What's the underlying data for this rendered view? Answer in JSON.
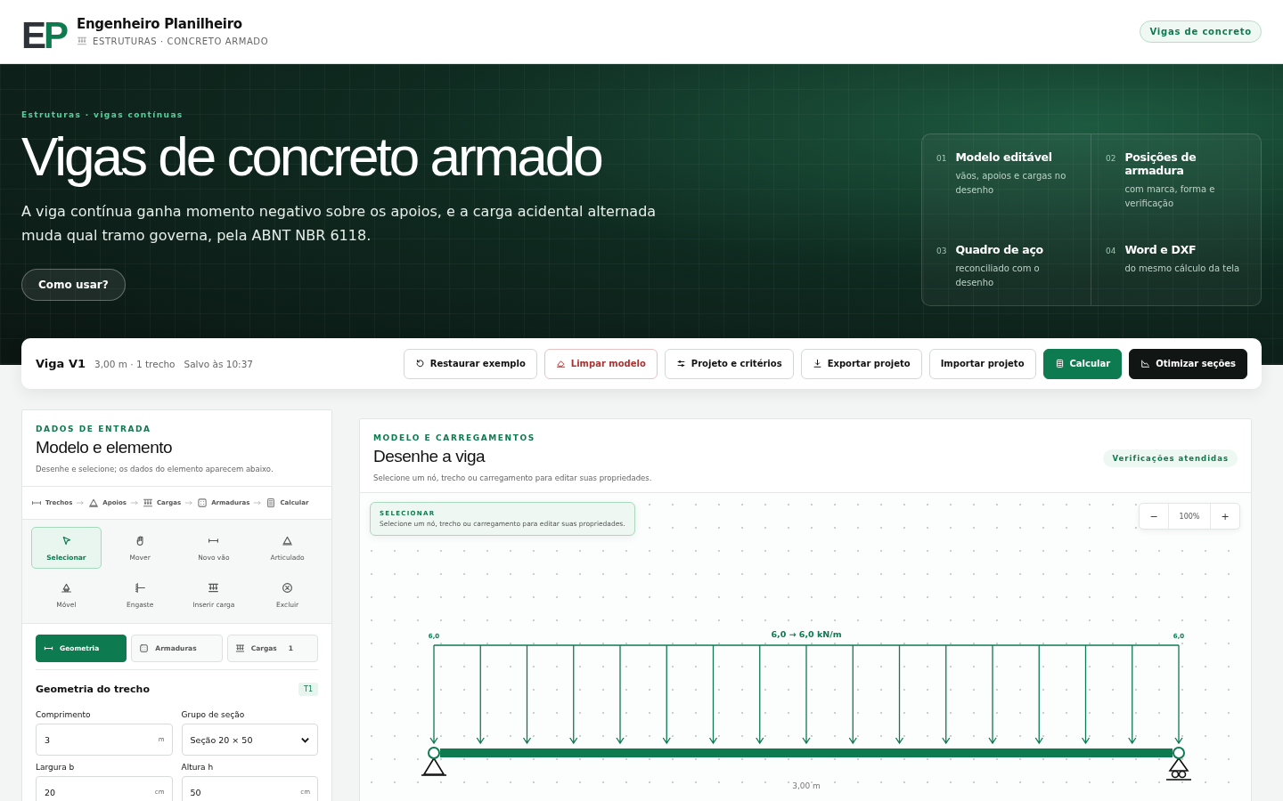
{
  "brand": {
    "logo": [
      "E",
      "P"
    ],
    "name": "Engenheiro Planilheiro",
    "subtitle": "ESTRUTURAS · CONCRETO ARMADO"
  },
  "header_badge": "Vigas de concreto",
  "hero": {
    "eyebrow": "Estruturas · vigas contínuas",
    "title": "Vigas de concreto armado",
    "lead": "A viga contínua ganha momento negativo sobre os apoios, e a carga acidental alternada muda qual tramo governa, pela ABNT NBR 6118.",
    "button": "Como usar?",
    "features": [
      {
        "number": "01",
        "title": "Modelo editável",
        "text": "vãos, apoios e cargas no desenho"
      },
      {
        "number": "02",
        "title": "Posições de armadura",
        "text": "com marca, forma e verificação"
      },
      {
        "number": "03",
        "title": "Quadro de aço",
        "text": "reconciliado com o desenho"
      },
      {
        "number": "04",
        "title": "Word e DXF",
        "text": "do mesmo cálculo da tela"
      }
    ]
  },
  "toolbar": {
    "title": "Viga V1",
    "meta": "3,00 m · 1 trecho",
    "saved": "Salvo às 10:37",
    "buttons": [
      {
        "label": "Restaurar exemplo",
        "kind": "default"
      },
      {
        "label": "Limpar modelo",
        "kind": "danger"
      },
      {
        "label": "Projeto e critérios",
        "kind": "default"
      },
      {
        "label": "Exportar projeto",
        "kind": "default"
      },
      {
        "label": "Importar projeto",
        "kind": "default"
      },
      {
        "label": "Calcular",
        "kind": "primary"
      },
      {
        "label": "Otimizar seções",
        "kind": "dark"
      }
    ]
  },
  "input_panel": {
    "eyebrow": "DADOS DE ENTRADA",
    "title": "Modelo e elemento",
    "description": "Desenhe e selecione; os dados do elemento aparecem abaixo.",
    "steps": [
      {
        "label": "Trechos",
        "kind": "span"
      },
      {
        "label": "Apoios",
        "kind": "pin"
      },
      {
        "label": "Cargas",
        "kind": "load"
      },
      {
        "label": "Armaduras",
        "kind": "grid"
      },
      {
        "label": "Calcular",
        "kind": "calculator"
      }
    ],
    "tools": [
      {
        "label": "Selecionar",
        "kind": "cursor",
        "selected": true
      },
      {
        "label": "Mover",
        "kind": "hand",
        "selected": false
      },
      {
        "label": "Novo vão",
        "kind": "span",
        "selected": false
      },
      {
        "label": "Articulado",
        "kind": "pin",
        "selected": false
      },
      {
        "label": "Móvel",
        "kind": "roller",
        "selected": false
      },
      {
        "label": "Engaste",
        "kind": "fixed",
        "selected": false
      },
      {
        "label": "Inserir carga",
        "kind": "load",
        "selected": false
      },
      {
        "label": "Excluir",
        "kind": "delete",
        "selected": false
      }
    ],
    "tabs": [
      {
        "label": "Geometria",
        "kind": "span",
        "selected": true
      },
      {
        "label": "Armaduras",
        "kind": "grid",
        "selected": false
      },
      {
        "label": "Cargas",
        "kind": "load",
        "count": "1",
        "selected": false
      }
    ],
    "section_title": "Geometria do trecho",
    "section_tag": "T1",
    "fields": [
      {
        "label": "Comprimento",
        "kind": "input",
        "value": "3",
        "unit": "m"
      },
      {
        "label": "Grupo de seção",
        "kind": "select",
        "value": "Seção 20 × 50"
      },
      {
        "label": "Largura b",
        "kind": "input",
        "value": "20",
        "unit": "cm"
      },
      {
        "label": "Altura h",
        "kind": "input",
        "value": "50",
        "unit": "cm"
      }
    ]
  },
  "model_panel": {
    "eyebrow": "MODELO E CARREGAMENTOS",
    "title": "Desenhe a viga",
    "description": "Selecione um nó, trecho ou carregamento para editar suas propriedades.",
    "status": "Verificações atendidas",
    "hint": {
      "title": "SELECIONAR",
      "text": "Selecione um nó, trecho ou carregamento para editar suas propriedades."
    },
    "zoom": {
      "minus": "−",
      "value": "100%",
      "plus": "+"
    },
    "beam": {
      "start_load": "6,0",
      "end_load": "6,0",
      "load_label": "6,0 → 6,0 kN/m",
      "span_label": "3,00 m",
      "supports": [
        {
          "kind": "pin"
        },
        {
          "kind": "roller"
        }
      ]
    }
  }
}
